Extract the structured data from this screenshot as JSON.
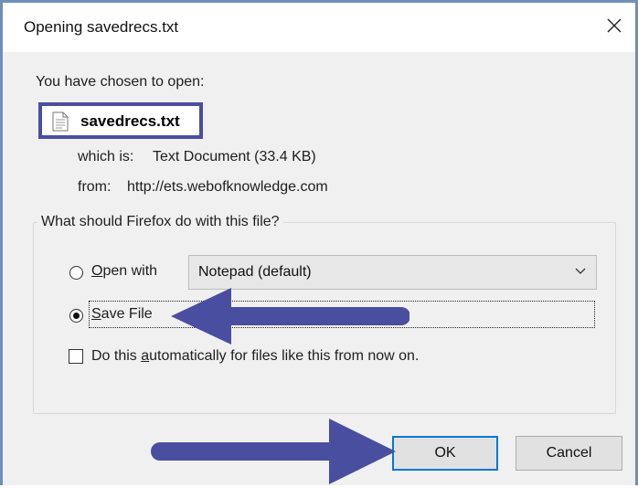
{
  "dialog": {
    "title": "Opening savedrecs.txt",
    "close_glyph": "✕"
  },
  "intro": "You have chosen to open:",
  "file": {
    "name": "savedrecs.txt",
    "icon": "text-file-icon",
    "which_is_label": "which is:",
    "which_is_value": "Text Document (33.4 KB)",
    "from_label": "from:",
    "from_value": "http://ets.webofknowledge.com"
  },
  "action_group": {
    "legend": "What should Firefox do with this file?",
    "open_with": {
      "label_access_key": "O",
      "label_rest": "pen with",
      "selected": false
    },
    "app_select": {
      "value": "Notepad (default)"
    },
    "save_file": {
      "label_access_key": "S",
      "label_rest": "ave File",
      "selected": true
    },
    "auto_checkbox": {
      "label_before": "Do this ",
      "label_access_key": "a",
      "label_after": "utomatically for files like this from now on.",
      "checked": false
    }
  },
  "buttons": {
    "ok": "OK",
    "cancel": "Cancel"
  },
  "colors": {
    "annotation_arrow": "#4a4ea0",
    "highlight_box": "#4a4ea0",
    "default_button_border": "#0078d7",
    "window_border": "#6f8fb8"
  }
}
